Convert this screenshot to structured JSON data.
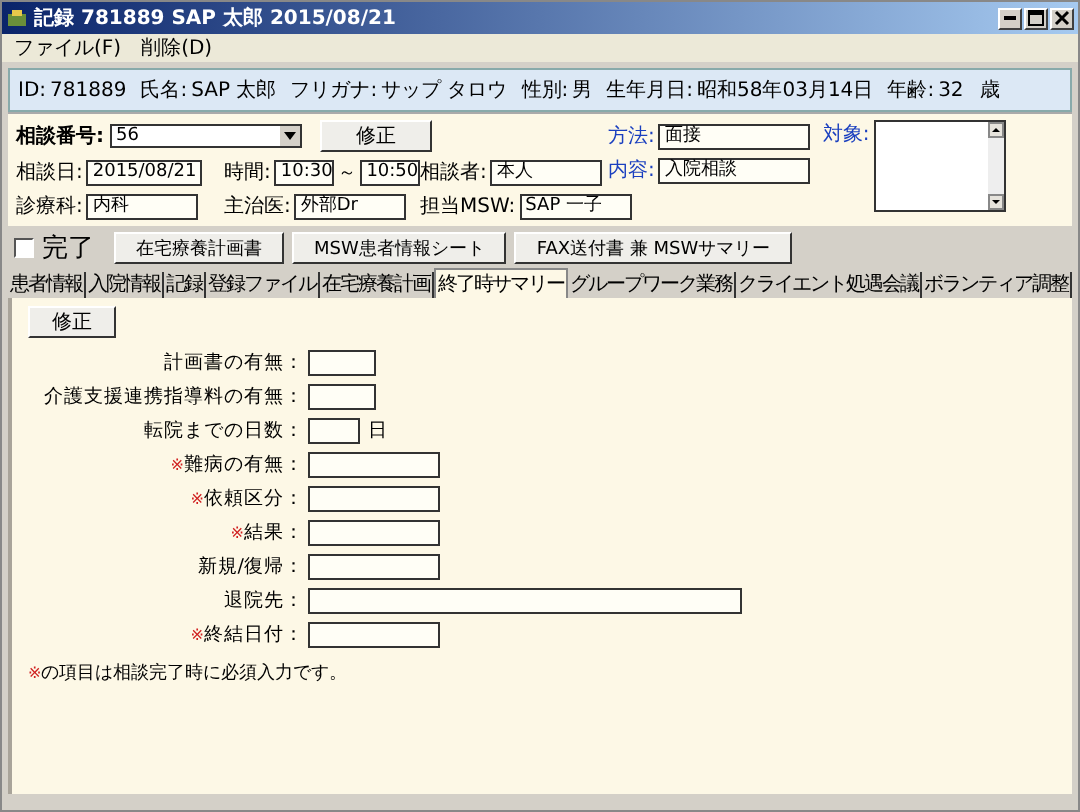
{
  "window": {
    "title": "記録 781889 SAP 太郎 2015/08/21"
  },
  "menu": [
    "ファイル(F)",
    "削除(D)"
  ],
  "patient": [
    {
      "label": "ID:",
      "value": "781889"
    },
    {
      "label": "氏名:",
      "value": "SAP 太郎"
    },
    {
      "label": "フリガナ:",
      "value": "サップ タロウ"
    },
    {
      "label": "性別:",
      "value": "男"
    },
    {
      "label": "生年月日:",
      "value": "昭和58年03月14日"
    },
    {
      "label": "年齢:",
      "value": "32",
      "unit": "歳"
    }
  ],
  "consultation": {
    "number_label": "相談番号:",
    "number": "56",
    "edit_button": "修正",
    "rows": [
      [
        {
          "label": "相談日:",
          "value": "2015/08/21"
        },
        {
          "label": "時間:",
          "value": "10:30",
          "separator": "～",
          "value_end": "10:50"
        },
        {
          "label": "相談者:",
          "value": "本人"
        }
      ],
      [
        {
          "label": "診療科:",
          "value": "内科"
        },
        {
          "label": "主治医:",
          "value": "外部Dr"
        },
        {
          "label": "担当MSW:",
          "value": "SAP 一子"
        }
      ]
    ],
    "side_fields": [
      {
        "label": "方法:",
        "value": "面接"
      },
      {
        "label": "内容:",
        "value": "入院相談"
      }
    ],
    "target_label": "対象:"
  },
  "completed": {
    "label": "完了",
    "checked": false
  },
  "action_buttons": [
    "在宅療養計画書",
    "MSW患者情報シート",
    "FAX送付書 兼 MSWサマリー"
  ],
  "tabs": [
    {
      "label": "患者情報",
      "selected": false
    },
    {
      "label": "入院情報",
      "selected": false
    },
    {
      "label": "記録",
      "selected": false
    },
    {
      "label": "登録ファイル",
      "selected": false
    },
    {
      "label": "在宅療養計画",
      "selected": false
    },
    {
      "label": "終了時サマリー",
      "selected": true
    },
    {
      "label": "グループワーク業務",
      "selected": false
    },
    {
      "label": "クライエント処遇会議",
      "selected": false
    },
    {
      "label": "ボランティア調整",
      "selected": false
    }
  ],
  "summary": {
    "edit_button": "修正",
    "fields": [
      {
        "label": "計画書の有無：",
        "kind": "short"
      },
      {
        "label": "介護支援連携指導料の有無：",
        "kind": "short"
      },
      {
        "label": "転院までの日数：",
        "kind": "tiny",
        "unit": "日"
      },
      {
        "mark": "※",
        "label": "難病の有無：",
        "kind": "medium"
      },
      {
        "mark": "※",
        "label": "依頼区分：",
        "kind": "medium"
      },
      {
        "mark": "※",
        "label": "結果：",
        "kind": "medium"
      },
      {
        "label": "新規/復帰：",
        "kind": "medium"
      },
      {
        "label": "退院先：",
        "kind": "wide"
      },
      {
        "mark": "※",
        "label": "終結日付：",
        "kind": "medium"
      }
    ],
    "note": {
      "mark": "※",
      "text": "の項目は相談完了時に必須入力です。"
    }
  }
}
